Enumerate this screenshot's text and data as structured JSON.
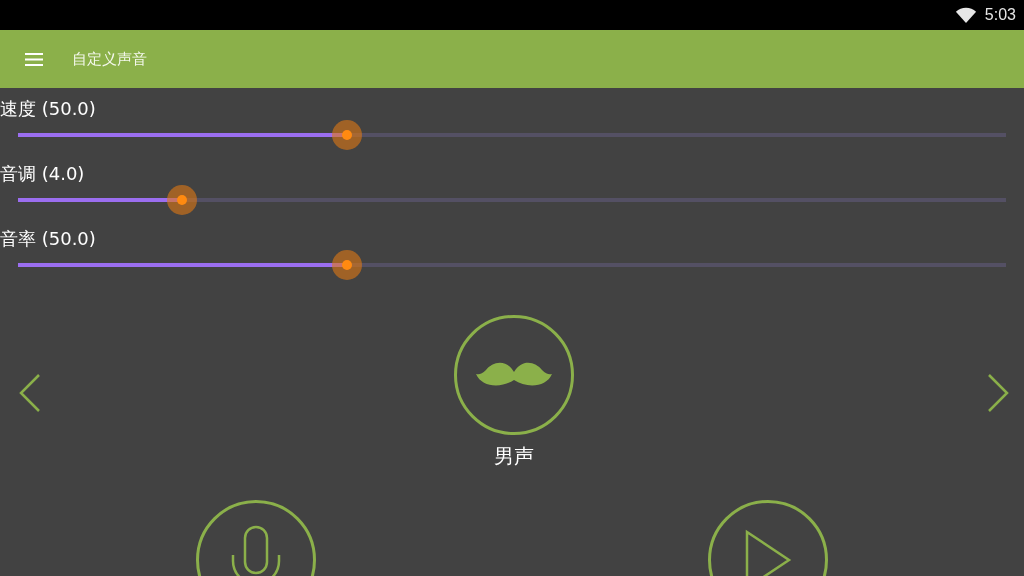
{
  "status_bar": {
    "time": "5:03"
  },
  "app_bar": {
    "title": "自定义声音"
  },
  "sliders": [
    {
      "label": "速度 (50.0)",
      "level": 0.333
    },
    {
      "label": "音调 (4.0)",
      "level": 0.166
    },
    {
      "label": "音率 (50.0)",
      "level": 0.333
    }
  ],
  "voice": {
    "label": "男声"
  }
}
